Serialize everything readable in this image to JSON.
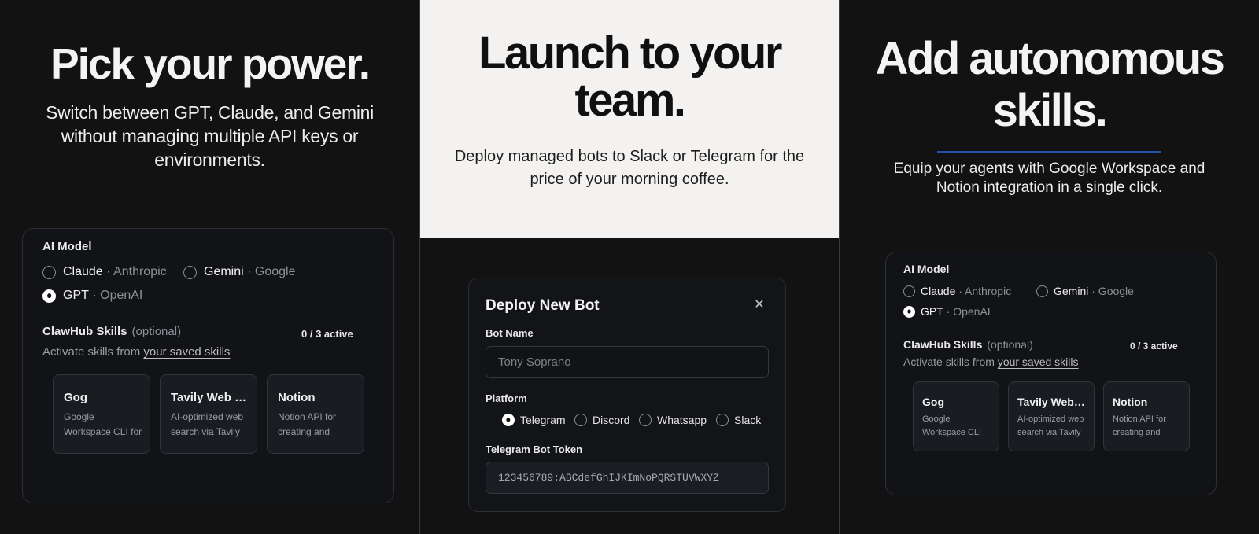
{
  "panel1": {
    "headline": "Pick your power.",
    "subtitle": "Switch between GPT, Claude, and Gemini without managing multiple API keys or environments."
  },
  "panel2": {
    "headline_line1": "Launch to your",
    "headline_line2": "team.",
    "subtitle": "Deploy managed bots to Slack or Telegram for the price of your morning coffee."
  },
  "panel3": {
    "headline_line1": "Add autonomous",
    "headline_line2": "skills.",
    "subtitle": "Equip your agents with Google Workspace and Notion integration in a single click."
  },
  "config_card": {
    "ai_model_label": "AI Model",
    "models": [
      {
        "name": "Claude",
        "provider": "· Anthropic",
        "selected": false
      },
      {
        "name": "Gemini",
        "provider": "· Google",
        "selected": false
      },
      {
        "name": "GPT",
        "provider": "· OpenAI",
        "selected": true
      }
    ],
    "skills_label": "ClawHub Skills",
    "skills_optional": "(optional)",
    "active_count": "0 / 3 active",
    "activate_prefix": "Activate skills from",
    "activate_link": "your saved skills",
    "skills": [
      {
        "title": "Gog",
        "description": "Google Workspace CLI for Gmail, Calendar, Drive"
      },
      {
        "title": "Tavily Web Search",
        "description": "AI-optimized web search via Tavily API"
      },
      {
        "title": "Notion",
        "description": "Notion API for creating and managing pages"
      }
    ]
  },
  "deploy_dialog": {
    "title": "Deploy New Bot",
    "close_glyph": "✕",
    "bot_name_label": "Bot Name",
    "bot_name_placeholder": "Tony Soprano",
    "platform_label": "Platform",
    "platforms": [
      {
        "name": "Telegram",
        "selected": true
      },
      {
        "name": "Discord",
        "selected": false
      },
      {
        "name": "Whatsapp",
        "selected": false
      },
      {
        "name": "Slack",
        "selected": false
      }
    ],
    "token_label": "Telegram Bot Token",
    "token_value": "123456789:ABCdefGhIJKImNoPQRSTUVWXYZ"
  },
  "colors": {
    "dark_bg": "#121212",
    "light_bg": "#f3f2f0",
    "accent_rule": "#1f56a8"
  }
}
